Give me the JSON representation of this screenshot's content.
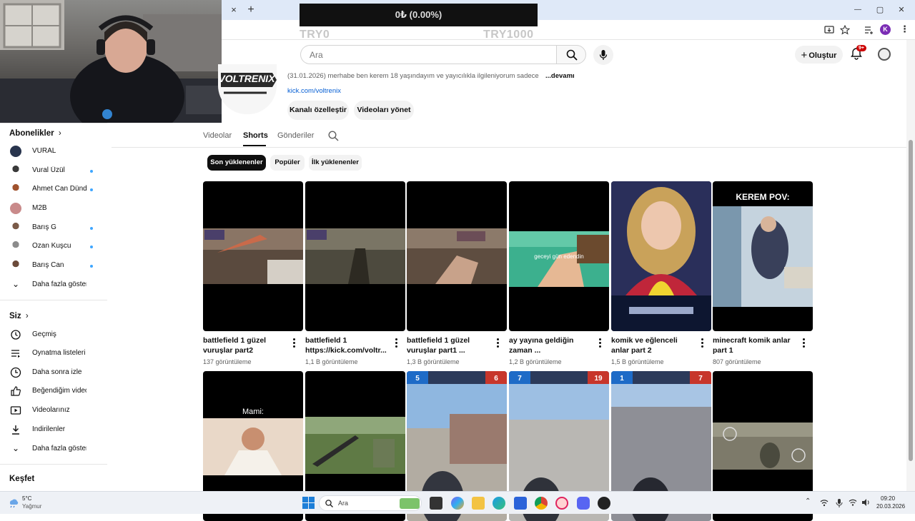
{
  "browser": {
    "new_tab": "+",
    "close_tab": "×",
    "win_min": "—",
    "win_max": "▢",
    "win_close": "✕",
    "profile_letter": "K"
  },
  "overlay": {
    "donation_amount": "0₺ (0.00%)",
    "goal_min": "TRY0",
    "goal_max": "TRY1000"
  },
  "header": {
    "search_placeholder": "Ara",
    "create_label": "Oluştur",
    "notifications_badge": "9+"
  },
  "channel": {
    "logo_text": "VOLTRENIX",
    "description": "(31.01.2026) merhabe ben kerem 18 yaşındayım ve yayıcılıkla ilgileniyorum sadece 1",
    "more_link": "...devamı",
    "link": "kick.com/voltrenix",
    "customize_button": "Kanalı özelleştir",
    "manage_button": "Videoları yönet"
  },
  "tabs": [
    {
      "label": "Videolar",
      "active": false
    },
    {
      "label": "Shorts",
      "active": true
    },
    {
      "label": "Gönderiler",
      "active": false
    }
  ],
  "chips": [
    {
      "label": "Son yüklenenler",
      "active": true
    },
    {
      "label": "Popüler",
      "active": false
    },
    {
      "label": "İlk yüklenenler",
      "active": false
    }
  ],
  "sidebar": {
    "subscriptions_title": "Abonelikler",
    "subscriptions": [
      {
        "label": "VURAL",
        "dot": false
      },
      {
        "label": "Vural Üzül",
        "dot": true
      },
      {
        "label": "Ahmet Can Dünd...",
        "dot": true
      },
      {
        "label": "M2B",
        "dot": false
      },
      {
        "label": "Barış G",
        "dot": true
      },
      {
        "label": "Ozan Kuşcu",
        "dot": true
      },
      {
        "label": "Barış Can",
        "dot": true
      }
    ],
    "show_more": "Daha fazla göster",
    "you_title": "Siz",
    "you_items": [
      {
        "label": "Geçmiş",
        "icon": "history-icon"
      },
      {
        "label": "Oynatma listeleri",
        "icon": "playlist-icon"
      },
      {
        "label": "Daha sonra izle",
        "icon": "watch-later-icon"
      },
      {
        "label": "Beğendiğim videolar",
        "icon": "like-icon"
      },
      {
        "label": "Videolarınız",
        "icon": "your-videos-icon"
      },
      {
        "label": "İndirilenler",
        "icon": "download-icon"
      }
    ],
    "show_more_2": "Daha fazla göster",
    "explore_title": "Keşfet"
  },
  "shorts": [
    {
      "title": "battlefield 1 güzel vuruşlar part2",
      "views": "137 görüntüleme"
    },
    {
      "title": "battlefield 1 https://kick.com/voltr...",
      "views": "1,1 B görüntüleme"
    },
    {
      "title": "battlefield 1 güzel vuruşlar part1 ...",
      "views": "1,3 B görüntüleme"
    },
    {
      "title": "ay yayına geldiğin zaman ...",
      "views": "1,2 B görüntüleme"
    },
    {
      "title": "komik ve eğlenceli anlar part 2",
      "views": "1,5 B görüntüleme"
    },
    {
      "title": "minecraft komik anlar part 1",
      "views": "807 görüntüleme"
    }
  ],
  "thumb_texts": {
    "overlay_4": "geceyi gün edendin",
    "overlay_6": "KEREM POV:",
    "overlay_7": "Mami:",
    "hud_3_left": "5",
    "hud_3_right": "6",
    "hud_4_left": "7",
    "hud_4_right": "19",
    "hud_5_left": "1",
    "hud_5_right": "7"
  },
  "taskbar": {
    "temp": "5°C",
    "weather": "Yağmur",
    "search": "Ara",
    "time": "09:20",
    "date": "20.03.2026"
  }
}
